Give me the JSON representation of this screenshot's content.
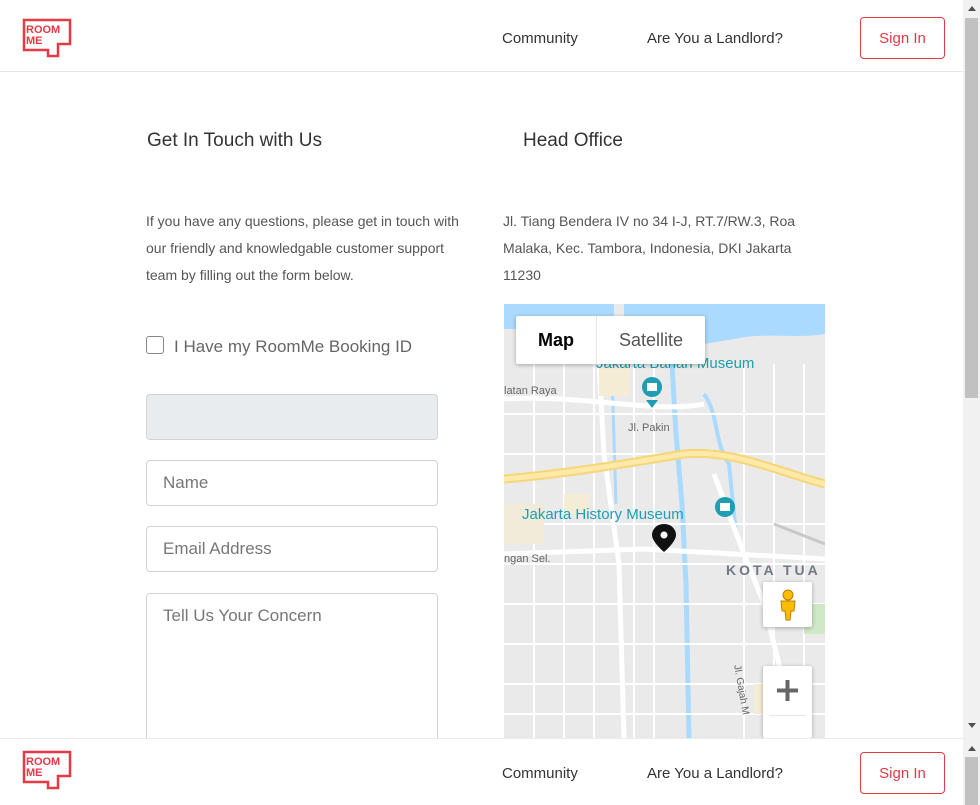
{
  "header": {
    "logo_text_1": "ROOM",
    "logo_text_2": "ME",
    "nav": {
      "community": "Community",
      "landlord": "Are You a Landlord?",
      "sign_in": "Sign In"
    }
  },
  "contact": {
    "title": "Get In Touch with Us",
    "intro": "If you have any questions, please get in touch with our friendly and knowledgable customer support team by filling out the form below.",
    "booking_checkbox_label": "I Have my RoomMe Booking ID",
    "booking_checked": false,
    "booking_id_value": "",
    "name_placeholder": "Name",
    "email_placeholder": "Email Address",
    "concern_placeholder": "Tell Us Your Concern"
  },
  "office": {
    "title": "Head Office",
    "address": "Jl. Tiang Bendera IV no 34 I-J, RT.7/RW.3, Roa Malaka, Kec. Tambora, Indonesia, DKI Jakarta 11230"
  },
  "map": {
    "type_map": "Map",
    "type_satellite": "Satellite",
    "labels": {
      "bahari": "Jakarta Bahari Museum",
      "history": "Jakarta History Museum",
      "district": "KOTA TUA",
      "latan_raya": "latan Raya",
      "jl_pakin": "Jl. Pakin",
      "ngan_sel": "ngan Sel.",
      "jl_gajah": "Jl. Gajah M"
    },
    "icons": {
      "pegman": "pegman-icon",
      "zoom": "plus-icon",
      "marker": "map-pin-icon"
    }
  },
  "colors": {
    "brand": "#e53945",
    "poi": "#1e9eb3"
  }
}
